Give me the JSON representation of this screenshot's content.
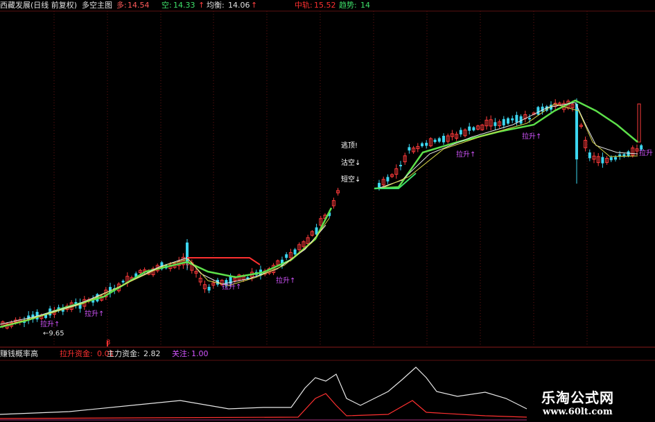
{
  "header": {
    "title": "西藏发展(日线 前复权)",
    "indicator": "多空主图",
    "long_label": "多:",
    "long_value": "14.54",
    "short_label": "空:",
    "short_value": "14.33",
    "balance_label": "均衡:",
    "balance_value": "14.06",
    "mid_label": "中轨:",
    "mid_value": "15.52",
    "trend_label": "趋势:",
    "trend_value": "14"
  },
  "sub_panel": {
    "title": "赚钱概率高",
    "lift_label": "拉升资金:",
    "lift_value": "0.01",
    "main_label": "主力资金:",
    "main_value": "2.82",
    "focus_label": "关注:",
    "focus_value": "1.00"
  },
  "chart": {
    "low_marker": "9.65",
    "signal_escape": "逃顶!",
    "signal_short_a": "沽空↓",
    "signal_short_b": "短空↓",
    "rise_tag": "拉升↑",
    "rise_tag_short": "拉升",
    "sub_marker": "8"
  },
  "colors": {
    "up": "#ff3b3b",
    "down": "#3cd6f0",
    "ma_white": "#e8e8e8",
    "ma_green": "#5de04a",
    "ma_yellow": "#d8d84a",
    "tag_purple": "#d455ff",
    "grid": "#6b1414"
  },
  "watermark": {
    "site_name": "乐淘公式网",
    "url": "www.60lt.com"
  }
}
